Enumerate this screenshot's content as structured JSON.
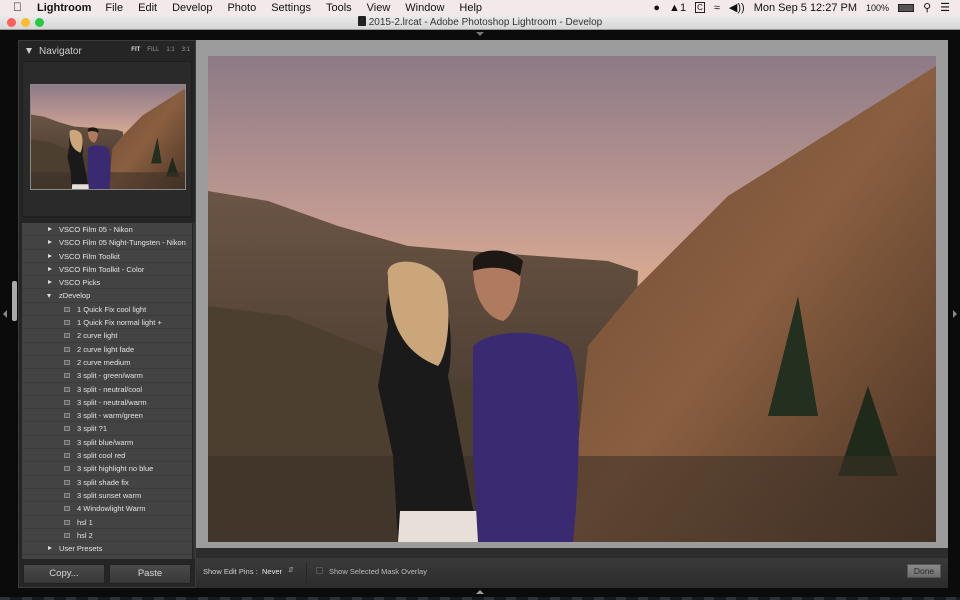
{
  "menubar": {
    "app_name": "Lightroom",
    "items": [
      "File",
      "Edit",
      "Develop",
      "Photo",
      "Settings",
      "Tools",
      "View",
      "Window",
      "Help"
    ],
    "status": {
      "adobe_count": "1",
      "clock": "Mon Sep 5  12:27 PM",
      "battery": "100%",
      "icons": [
        "dropbox-icon",
        "creative-cloud-icon",
        "cc-icon",
        "wifi-icon",
        "volume-icon",
        "battery-icon",
        "spotlight-icon",
        "notification-center-icon"
      ]
    }
  },
  "window": {
    "title": "2015-2.lrcat - Adobe Photoshop Lightroom - Develop"
  },
  "navigator": {
    "title": "Navigator",
    "zoom_options": [
      "FIT",
      "FILL",
      "1:1",
      "3:1"
    ],
    "active_zoom": "FIT"
  },
  "presets": {
    "folders_before": [
      "VSCO Film 05 - Nikon",
      "VSCO Film 05 Night-Tungsten - Nikon",
      "VSCO Film Toolkit",
      "VSCO Film Toolkit - Color",
      "VSCO Picks"
    ],
    "open_folder": "zDevelop",
    "items": [
      "1 Quick Fix cool light",
      "1 Quick Fix normal light  +",
      "2 curve light",
      "2 curve light fade",
      "2 curve medium",
      "3 split - green/warm",
      "3 split - neutral/cool",
      "3 split - neutral/warm",
      "3 split - warm/green",
      "3 split ?1",
      "3 split blue/warm",
      "3 split cool red",
      "3 split highlight no blue",
      "3 split shade fix",
      "3 split sunset warm",
      "4 Windowlight Warm",
      "hsl 1",
      "hsl 2"
    ],
    "folders_after": [
      "User Presets"
    ]
  },
  "buttons": {
    "copy": "Copy...",
    "paste": "Paste",
    "done": "Done"
  },
  "toolbar": {
    "edit_pins_label": "Show Edit Pins :",
    "edit_pins_value": "Never",
    "mask_overlay_label": "Show Selected Mask Overlay",
    "mask_overlay_checked": false
  },
  "colors": {
    "panel_bg": "#252525",
    "preset_bg": "#434343",
    "canvas_bg": "#9c9c9c"
  }
}
